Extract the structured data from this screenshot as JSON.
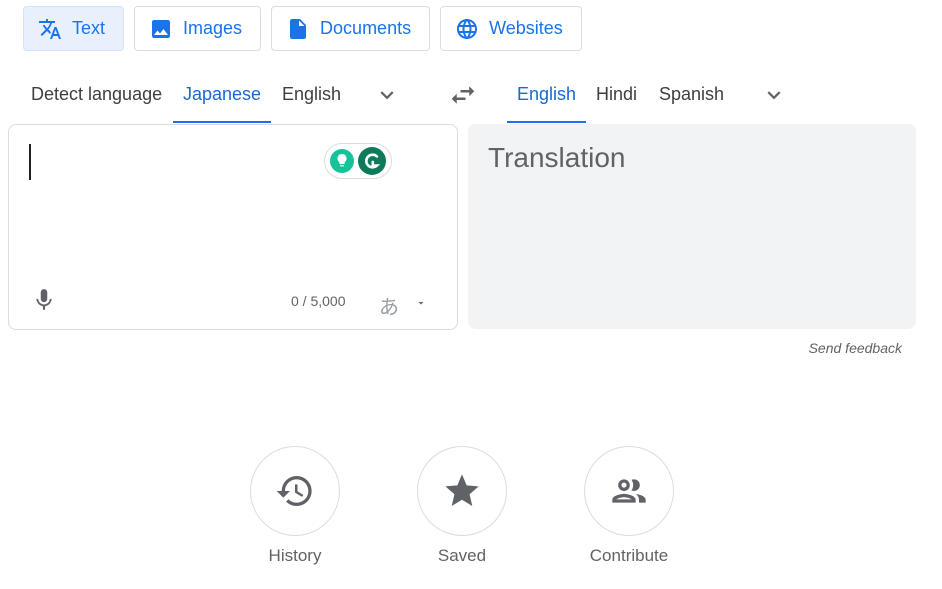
{
  "mode_tabs": [
    {
      "label": "Text",
      "icon": "translate-icon",
      "active": true
    },
    {
      "label": "Images",
      "icon": "image-icon",
      "active": false
    },
    {
      "label": "Documents",
      "icon": "document-icon",
      "active": false
    },
    {
      "label": "Websites",
      "icon": "globe-icon",
      "active": false
    }
  ],
  "source_langs": {
    "detect": "Detect language",
    "items": [
      "Japanese",
      "English"
    ],
    "active": "Japanese"
  },
  "target_langs": {
    "items": [
      "English",
      "Hindi",
      "Spanish"
    ],
    "active": "English"
  },
  "source": {
    "value": "",
    "char_count": "0 / 5,000",
    "ime_char": "あ"
  },
  "target": {
    "placeholder": "Translation"
  },
  "feedback_label": "Send feedback",
  "actions": [
    {
      "label": "History",
      "icon": "history-icon"
    },
    {
      "label": "Saved",
      "icon": "star-icon"
    },
    {
      "label": "Contribute",
      "icon": "contribute-icon"
    }
  ],
  "colors": {
    "accent": "#1a73e8",
    "active_tab_bg": "#e8f0fe",
    "target_bg": "#f1f3f4",
    "grammarly_green": "#15c39a",
    "grammarly_dark": "#0e7a5b"
  }
}
